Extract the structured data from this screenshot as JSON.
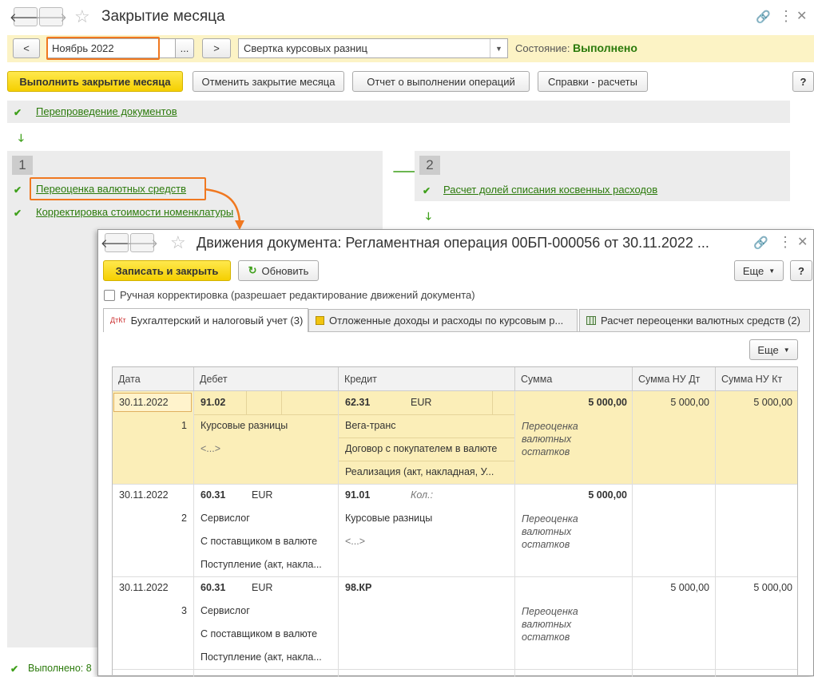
{
  "main": {
    "title": "Закрытие месяца",
    "period_prev": "<",
    "period_value": "Ноябрь 2022",
    "period_select": "...",
    "period_next": ">",
    "operation_select": "Свертка курсовых разниц",
    "state_label": "Состояние:",
    "state_value": "Выполнено",
    "buttons": {
      "run": "Выполнить закрытие месяца",
      "cancel": "Отменить закрытие месяца",
      "report": "Отчет о выполнении операций",
      "refs": "Справки - расчеты",
      "help": "?"
    },
    "repost_link": "Перепроведение документов",
    "step1": {
      "num": "1",
      "items": [
        "Переоценка валютных средств",
        "Корректировка стоимости номенклатуры"
      ]
    },
    "step2": {
      "num": "2",
      "items": [
        "Расчет долей списания косвенных расходов"
      ]
    },
    "footer_status": "Выполнено: 8"
  },
  "dialog": {
    "title": "Движения документа: Регламентная операция 00БП-000056 от 30.11.2022 ...",
    "buttons": {
      "save_close": "Записать и закрыть",
      "refresh": "Обновить",
      "more": "Еще",
      "help": "?",
      "more_grid": "Еще"
    },
    "manual_label": "Ручная корректировка (разрешает редактирование движений документа)",
    "tabs": [
      {
        "label": "Бухгалтерский и налоговый учет (3)",
        "icon": "ДтКт"
      },
      {
        "label": "Отложенные доходы и расходы по курсовым р..."
      },
      {
        "label": "Расчет переоценки валютных средств (2)"
      }
    ],
    "columns": {
      "date": "Дата",
      "debit": "Дебет",
      "credit": "Кредит",
      "sum": "Сумма",
      "sum_nu_dt": "Сумма НУ Дт",
      "sum_nu_kt": "Сумма НУ Кт"
    },
    "rows": [
      {
        "date": "30.11.2022",
        "num": "1",
        "debit_account": "91.02",
        "debit_currency": "",
        "debit_sub": [
          "Курсовые разницы",
          "<...>",
          ""
        ],
        "credit_account": "62.31",
        "credit_currency": "EUR",
        "credit_qty": "",
        "credit_sub": [
          "Вега-транс",
          "Договор с покупателем в валюте",
          "Реализация (акт, накладная, У..."
        ],
        "sum": "5 000,00",
        "content": "Переоценка валютных остатков",
        "sum_nu_dt": "5 000,00",
        "sum_nu_kt": "5 000,00"
      },
      {
        "date": "30.11.2022",
        "num": "2",
        "debit_account": "60.31",
        "debit_currency": "EUR",
        "debit_sub": [
          "Сервислог",
          "С поставщиком в валюте",
          "Поступление (акт, накла..."
        ],
        "credit_account": "91.01",
        "credit_currency": "",
        "credit_qty": "Кол.:",
        "credit_sub": [
          "Курсовые разницы",
          "<...>",
          ""
        ],
        "sum": "5 000,00",
        "content": "Переоценка валютных остатков",
        "sum_nu_dt": "",
        "sum_nu_kt": ""
      },
      {
        "date": "30.11.2022",
        "num": "3",
        "debit_account": "60.31",
        "debit_currency": "EUR",
        "debit_sub": [
          "Сервислог",
          "С поставщиком в валюте",
          "Поступление (акт, накла..."
        ],
        "credit_account": "98.КР",
        "credit_currency": "",
        "credit_qty": "",
        "credit_sub": [
          "",
          "",
          ""
        ],
        "sum": "",
        "content": "Переоценка валютных остатков",
        "sum_nu_dt": "5 000,00",
        "sum_nu_kt": "5 000,00"
      }
    ]
  },
  "colors": {
    "accent_green": "#2b7a0b",
    "highlight_orange": "#f07820",
    "selected_row": "#fbeeb8",
    "toolbar_yellow": "#fcf3c5"
  }
}
